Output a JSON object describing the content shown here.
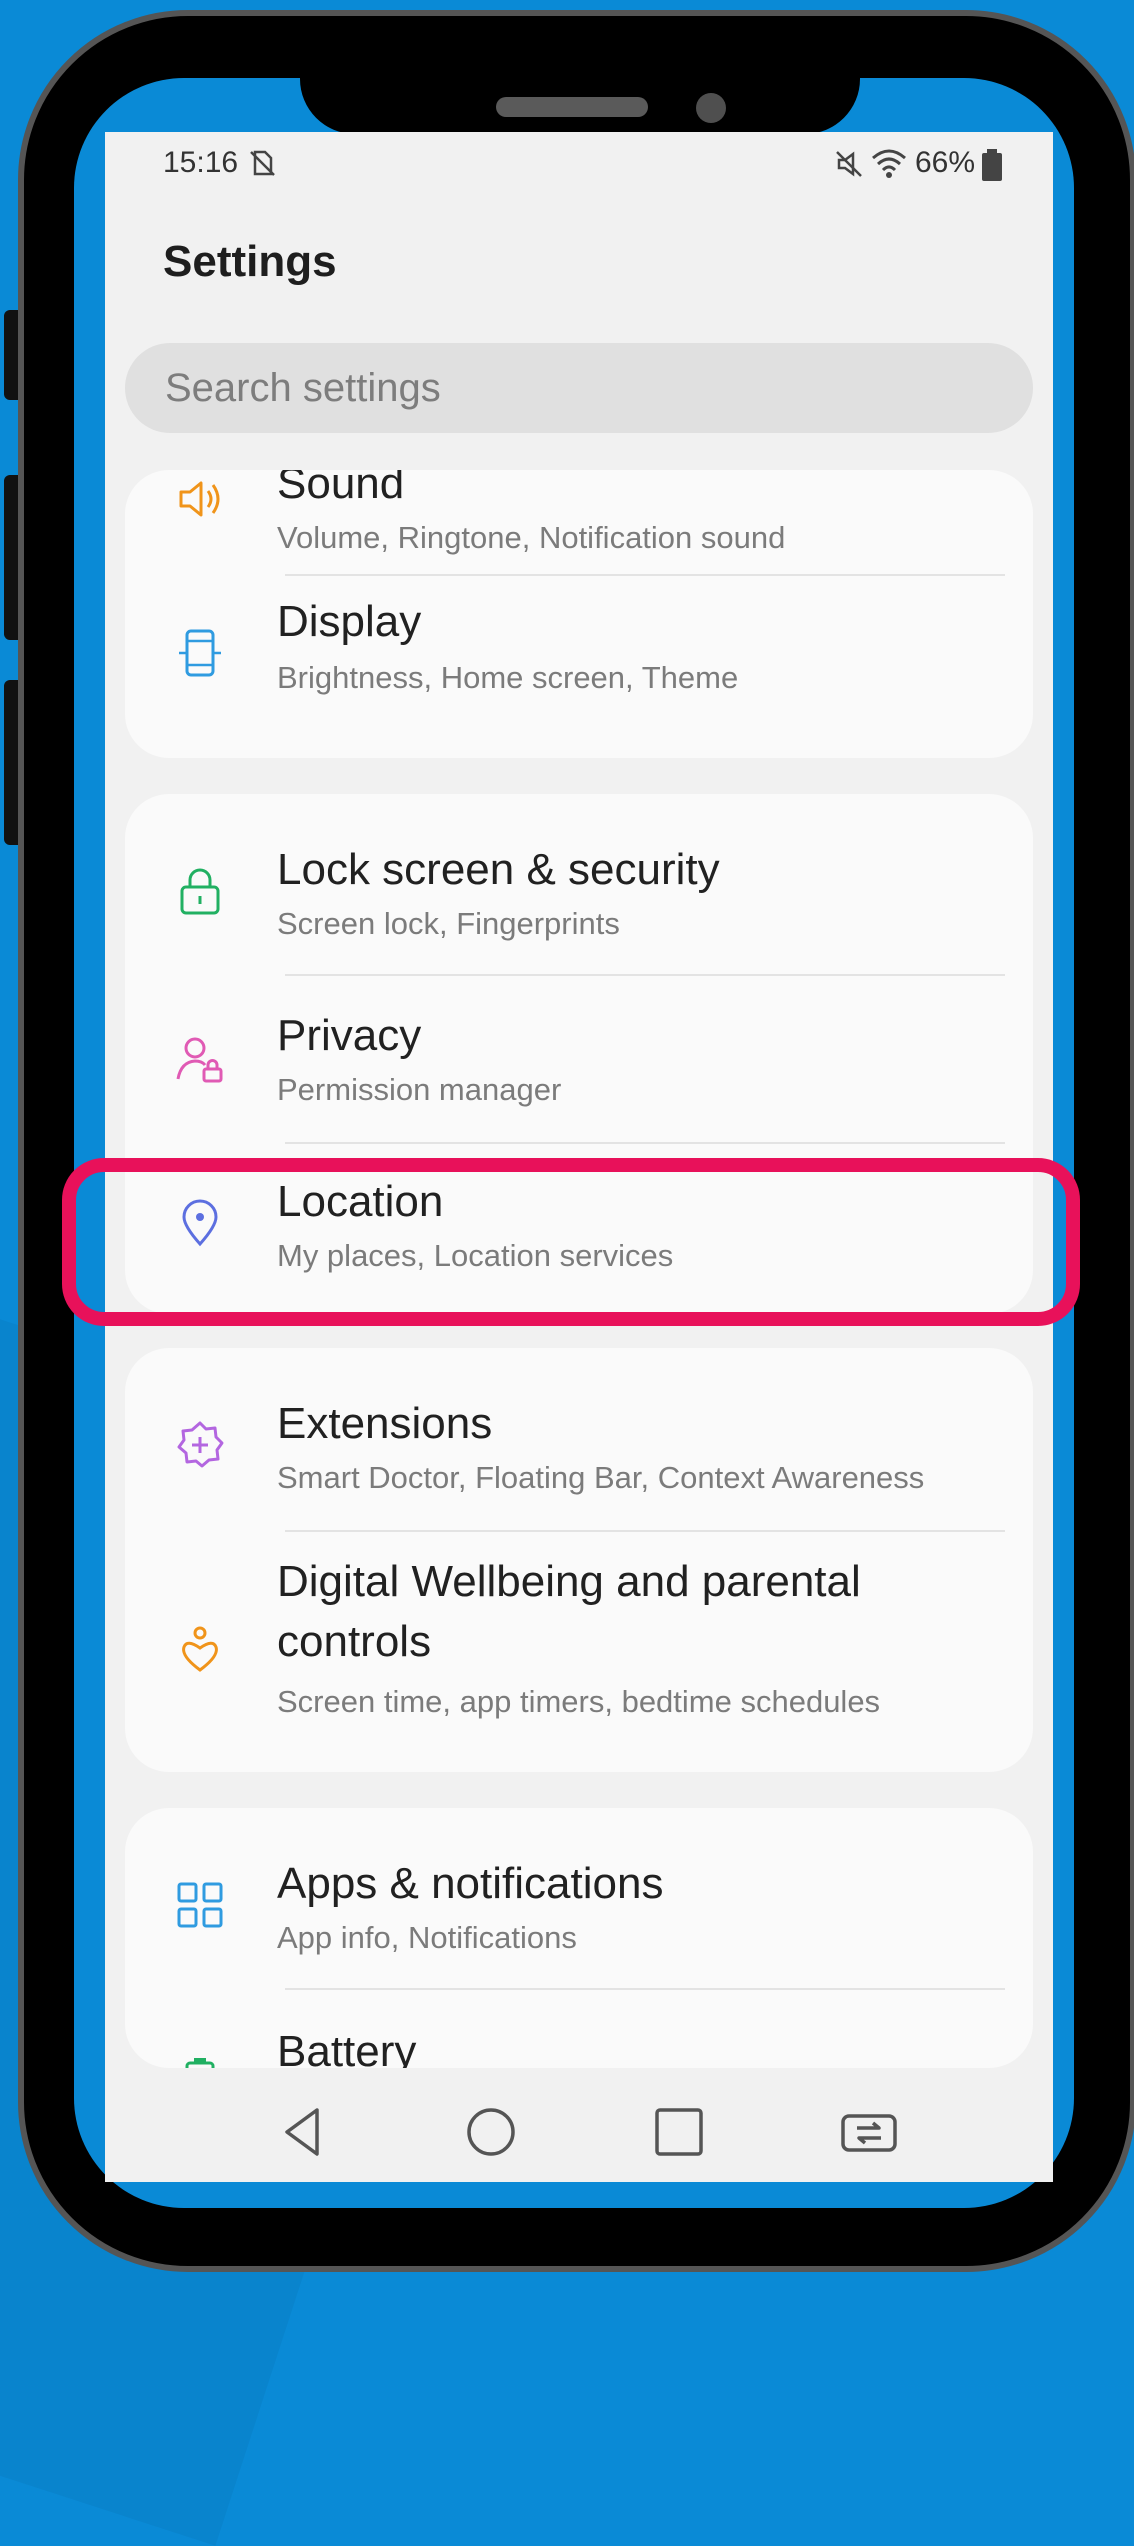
{
  "status_bar": {
    "time": "15:16",
    "battery": "66%"
  },
  "header": {
    "title": "Settings"
  },
  "search": {
    "placeholder": "Search settings"
  },
  "groups": [
    {
      "items": [
        {
          "label": "Sound",
          "sub": "Volume, Ringtone, Notification sound",
          "icon": "speaker-icon",
          "color": "#f0941a"
        },
        {
          "label": "Display",
          "sub": "Brightness, Home screen, Theme",
          "icon": "display-icon",
          "color": "#2f9be0"
        }
      ]
    },
    {
      "items": [
        {
          "label": "Lock screen & security",
          "sub": "Screen lock, Fingerprints",
          "icon": "lock-icon",
          "color": "#21b062"
        },
        {
          "label": "Privacy",
          "sub": "Permission manager",
          "icon": "privacy-icon",
          "color": "#e05ab4"
        },
        {
          "label": "Location",
          "sub": "My places, Location services",
          "icon": "location-pin-icon",
          "color": "#5c6fe0"
        }
      ]
    },
    {
      "items": [
        {
          "label": "Extensions",
          "sub": "Smart Doctor, Floating Bar, Context Awareness",
          "icon": "extensions-icon",
          "color": "#b366e0"
        },
        {
          "label": "Digital Wellbeing and parental controls",
          "sub": "Screen time, app timers, bedtime schedules",
          "icon": "wellbeing-icon",
          "color": "#f0941a"
        }
      ]
    },
    {
      "items": [
        {
          "label": "Apps & notifications",
          "sub": "App info, Notifications",
          "icon": "apps-grid-icon",
          "color": "#2f9be0"
        },
        {
          "label": "Battery",
          "sub": "",
          "icon": "battery-icon",
          "color": "#21b062"
        }
      ]
    }
  ],
  "highlight_color": "#e8115a",
  "nav_bar": {
    "buttons": [
      "back-icon",
      "home-icon",
      "recents-icon",
      "switch-apps-icon"
    ]
  }
}
